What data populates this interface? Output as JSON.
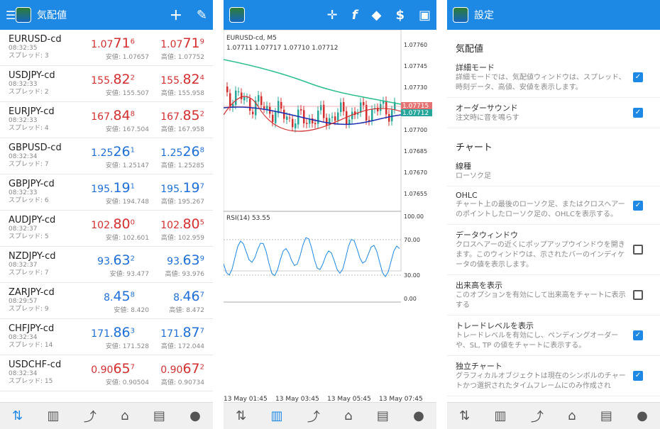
{
  "left": {
    "title": "気配値",
    "rows": [
      {
        "sym": "EURUSD-cd",
        "time": "08:32:35",
        "spread": "スプレッド: 3",
        "color": "red",
        "bid": {
          "a": "1.07",
          "b": "71",
          "c": "6"
        },
        "ask": {
          "a": "1.07",
          "b": "71",
          "c": "9"
        },
        "low": "安値: 1.07657",
        "high": "高値: 1.07752"
      },
      {
        "sym": "USDJPY-cd",
        "time": "08:32:33",
        "spread": "スプレッド: 2",
        "color": "red",
        "bid": {
          "a": "155.",
          "b": "82",
          "c": "2"
        },
        "ask": {
          "a": "155.",
          "b": "82",
          "c": "4"
        },
        "low": "安値: 155.507",
        "high": "高値: 155.958"
      },
      {
        "sym": "EURJPY-cd",
        "time": "08:32:33",
        "spread": "スプレッド: 4",
        "color": "red",
        "bid": {
          "a": "167.",
          "b": "84",
          "c": "8"
        },
        "ask": {
          "a": "167.",
          "b": "85",
          "c": "2"
        },
        "low": "安値: 167.504",
        "high": "高値: 167.958"
      },
      {
        "sym": "GBPUSD-cd",
        "time": "08:32:34",
        "spread": "スプレッド: 7",
        "color": "blue",
        "bid": {
          "a": "1.25",
          "b": "26",
          "c": "1"
        },
        "ask": {
          "a": "1.25",
          "b": "26",
          "c": "8"
        },
        "low": "安値: 1.25147",
        "high": "高値: 1.25285"
      },
      {
        "sym": "GBPJPY-cd",
        "time": "08:32:33",
        "spread": "スプレッド: 6",
        "color": "blue",
        "bid": {
          "a": "195.",
          "b": "19",
          "c": "1"
        },
        "ask": {
          "a": "195.",
          "b": "19",
          "c": "7"
        },
        "low": "安値: 194.748",
        "high": "高値: 195.267"
      },
      {
        "sym": "AUDJPY-cd",
        "time": "08:32:37",
        "spread": "スプレッド: 5",
        "color": "red",
        "bid": {
          "a": "102.",
          "b": "80",
          "c": "0"
        },
        "ask": {
          "a": "102.",
          "b": "80",
          "c": "5"
        },
        "low": "安値: 102.601",
        "high": "高値: 102.959"
      },
      {
        "sym": "NZDJPY-cd",
        "time": "08:32:37",
        "spread": "スプレッド: 7",
        "color": "blue",
        "bid": {
          "a": "93.",
          "b": "63",
          "c": "2"
        },
        "ask": {
          "a": "93.",
          "b": "63",
          "c": "9"
        },
        "low": "安値: 93.477",
        "high": "高値: 93.976"
      },
      {
        "sym": "ZARJPY-cd",
        "time": "08:29:57",
        "spread": "スプレッド: 9",
        "color": "blue",
        "bid": {
          "a": "8.",
          "b": "45",
          "c": "8"
        },
        "ask": {
          "a": "8.",
          "b": "46",
          "c": "7"
        },
        "low": "安値: 8.420",
        "high": "高値: 8.472"
      },
      {
        "sym": "CHFJPY-cd",
        "time": "08:32:34",
        "spread": "スプレッド: 14",
        "color": "blue",
        "bid": {
          "a": "171.",
          "b": "86",
          "c": "3"
        },
        "ask": {
          "a": "171.",
          "b": "87",
          "c": "7"
        },
        "low": "安値: 171.528",
        "high": "高値: 172.044"
      },
      {
        "sym": "USDCHF-cd",
        "time": "08:32:34",
        "spread": "スプレッド: 15",
        "color": "red",
        "bid": {
          "a": "0.90",
          "b": "65",
          "c": "7"
        },
        "ask": {
          "a": "0.90",
          "b": "67",
          "c": "2"
        },
        "low": "安値: 0.90504",
        "high": "高値: 0.90734"
      }
    ]
  },
  "chart": {
    "symbol": "EURUSD-cd, M5",
    "ohlc": "1.07711 1.07717 1.07710 1.07712",
    "price_ticks": [
      "1.07760",
      "1.07745",
      "1.07730",
      "1.07715",
      "1.07700",
      "1.07685",
      "1.07670",
      "1.07655"
    ],
    "bid_tag": "1.07715",
    "last_tag": "1.07712",
    "rsi_label": "RSI(14) 53.55",
    "rsi_ticks": [
      "100.00",
      "70.00",
      "30.00",
      "0.00"
    ],
    "time_ticks": [
      "13 May 01:45",
      "13 May 03:45",
      "13 May 05:45",
      "13 May 07:45"
    ]
  },
  "chart_data": {
    "type": "line",
    "title": "EURUSD-cd, M5",
    "ylim": [
      1.0765,
      1.0777
    ],
    "x": [
      "13 May 01:45",
      "13 May 03:45",
      "13 May 05:45",
      "13 May 07:45"
    ],
    "series": [
      {
        "name": "RSI(14)",
        "values": [
          53.55
        ]
      }
    ]
  },
  "settings": {
    "title": "設定",
    "sect1": "気配値",
    "sect2": "チャート",
    "rows1": [
      {
        "t": "詳細モード",
        "d": "詳細モードでは、気配値ウィンドウは、スプレッド、時刻データ、高値、安値を表示します。",
        "on": true
      },
      {
        "t": "オーダーサウンド",
        "d": "注文時に音を鳴らす",
        "on": true
      }
    ],
    "line_t": "線種",
    "line_d": "ローソク足",
    "rows2": [
      {
        "t": "OHLC",
        "d": "チャート上の最後のローソク足、またはクロスヘアーのポイントしたローソク足の、OHLCを表示する。",
        "on": true
      },
      {
        "t": "データウィンドウ",
        "d": "クロスヘアーの近くにポップアップウインドウを開きます。このウィンドウは、示されたバーのインディケータの値を表示します。",
        "on": false
      },
      {
        "t": "出来高を表示",
        "d": "このオプションを有効にして出来高をチャートに表示する",
        "on": false
      },
      {
        "t": "トレードレベルを表示",
        "d": "トレードレベルを有効にし、ペンディングオーダーや、SL, TP の値をチャートに表示する。",
        "on": true
      },
      {
        "t": "独立チャート",
        "d": "グラフィカルオブジェクトは現在のシンボルのチャートかつ選択されたタイムフレームにのみ作成され",
        "on": true
      }
    ]
  }
}
